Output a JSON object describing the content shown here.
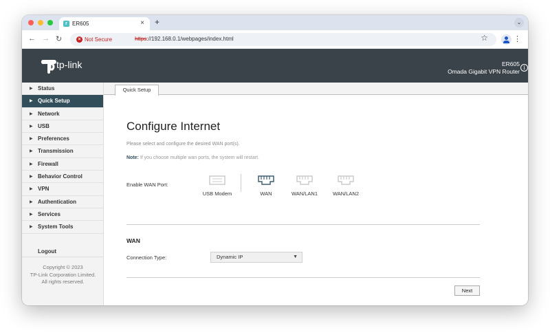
{
  "browser": {
    "tab_title": "ER605",
    "favicon_letter": "r",
    "security_label": "Not Secure",
    "url_protocol": "https",
    "url_rest": "://192.168.0.1/webpages/index.html"
  },
  "header": {
    "logo_text": "tp-link",
    "model": "ER605",
    "product": "Omada Gigabit VPN Router"
  },
  "sidebar": {
    "items": [
      {
        "label": "Status"
      },
      {
        "label": "Quick Setup"
      },
      {
        "label": "Network"
      },
      {
        "label": "USB"
      },
      {
        "label": "Preferences"
      },
      {
        "label": "Transmission"
      },
      {
        "label": "Firewall"
      },
      {
        "label": "Behavior Control"
      },
      {
        "label": "VPN"
      },
      {
        "label": "Authentication"
      },
      {
        "label": "Services"
      },
      {
        "label": "System Tools"
      }
    ],
    "active_index": 1,
    "logout": "Logout",
    "copyright_1": "Copyright © 2023",
    "copyright_2": "TP-Link Corporation Limited.",
    "copyright_3": "All rights reserved."
  },
  "main": {
    "tab_label": "Quick Setup",
    "title": "Configure Internet",
    "description": "Please select and configure the desired WAN port(s).",
    "note_label": "Note:",
    "note_text": " If you choose multiple wan ports, the system will restart.",
    "enable_wan_label": "Enable WAN Port:",
    "ports": [
      {
        "label": "USB Modem",
        "selected": false
      },
      {
        "label": "WAN",
        "selected": true
      },
      {
        "label": "WAN/LAN1",
        "selected": false
      },
      {
        "label": "WAN/LAN2",
        "selected": false
      }
    ],
    "section_title": "WAN",
    "connection_type_label": "Connection Type:",
    "connection_type_value": "Dynamic IP",
    "next_label": "Next"
  },
  "colors": {
    "header_bg": "#3a4349",
    "active_menu": "#314e5a",
    "port_selected": "#3d6170",
    "port_unselected": "#cccccc"
  }
}
